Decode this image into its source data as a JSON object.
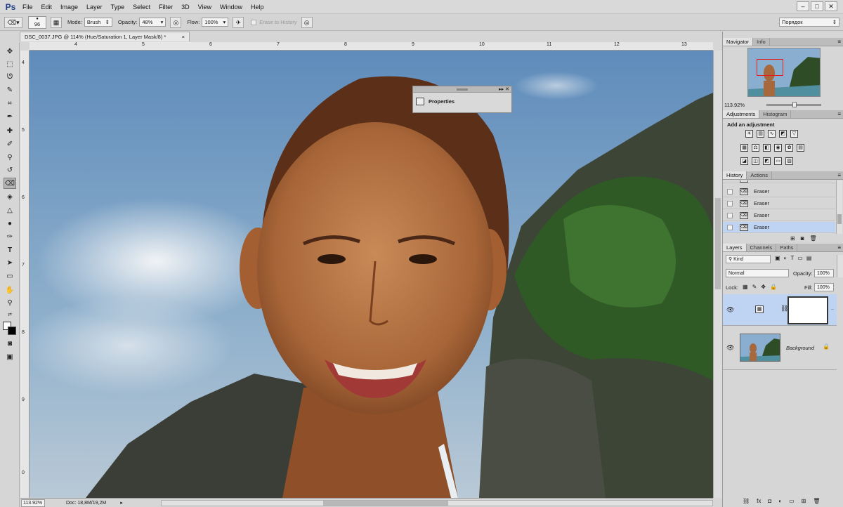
{
  "menubar": {
    "app_logo": "Ps",
    "items": [
      "File",
      "Edit",
      "Image",
      "Layer",
      "Type",
      "Select",
      "Filter",
      "3D",
      "View",
      "Window",
      "Help"
    ],
    "window_controls": [
      "–",
      "□",
      "✕"
    ]
  },
  "options_bar": {
    "brush_size": "96",
    "mode_label": "Mode:",
    "mode_value": "Brush",
    "opacity_label": "Opacity:",
    "opacity_value": "48%",
    "flow_label": "Flow:",
    "flow_value": "100%",
    "erase_to_history": "Erase to History",
    "workspace": "Порядок"
  },
  "document": {
    "tab_title": "DSC_0037.JPG @ 114% (Hue/Saturation 1, Layer Mask/8) *",
    "tab_close": "×",
    "zoom": "113.92%",
    "doc_size": "Doc: 18,8M/19,2M"
  },
  "rulers": {
    "top": [
      "4",
      "5",
      "6",
      "7",
      "8",
      "9",
      "10",
      "11",
      "12",
      "13"
    ],
    "left": [
      "4",
      "5",
      "6",
      "7",
      "8",
      "9",
      "0"
    ]
  },
  "properties_panel": {
    "title": "Properties",
    "controls": "▸▸ ✕"
  },
  "navigator": {
    "tabs": [
      "Navigator",
      "Info"
    ],
    "zoom": "113.92%"
  },
  "adjustments": {
    "tabs": [
      "Adjustments",
      "Histogram"
    ],
    "title": "Add an adjustment"
  },
  "history": {
    "tabs": [
      "History",
      "Actions"
    ],
    "items": [
      {
        "label": "Eraser",
        "selected": false
      },
      {
        "label": "Eraser",
        "selected": false
      },
      {
        "label": "Eraser",
        "selected": false
      },
      {
        "label": "Eraser",
        "selected": true
      }
    ]
  },
  "layers": {
    "tabs": [
      "Layers",
      "Channels",
      "Paths"
    ],
    "filter_kind": "Kind",
    "blend_mode": "Normal",
    "opacity_label": "Opacity:",
    "opacity_value": "100%",
    "lock_label": "Lock:",
    "fill_label": "Fill:",
    "fill_value": "100%",
    "background_name": "Background"
  },
  "colors": {
    "foreground": "#ffffff",
    "background": "#000000",
    "selection": "#bfd3f3"
  }
}
